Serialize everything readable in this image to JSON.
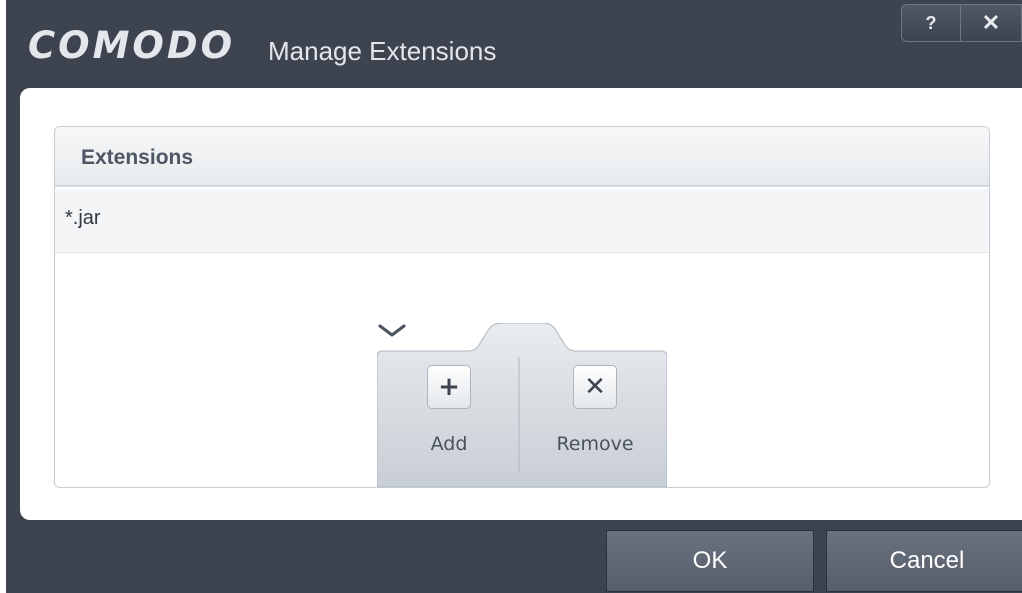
{
  "titlebar": {
    "brand": "COMODO",
    "title": "Manage Extensions",
    "help_label": "?",
    "close_label": "✕"
  },
  "panel": {
    "header": "Extensions",
    "items": [
      "*.jar"
    ]
  },
  "toolbar": {
    "add_label": "Add",
    "remove_label": "Remove",
    "add_icon": "plus-icon",
    "remove_icon": "x-icon"
  },
  "footer": {
    "ok_label": "OK",
    "cancel_label": "Cancel"
  },
  "colors": {
    "window_bg": "#3d4450",
    "content_bg": "#ffffff",
    "button_bg": "#5f6775",
    "text_light": "#e3e7ec"
  }
}
